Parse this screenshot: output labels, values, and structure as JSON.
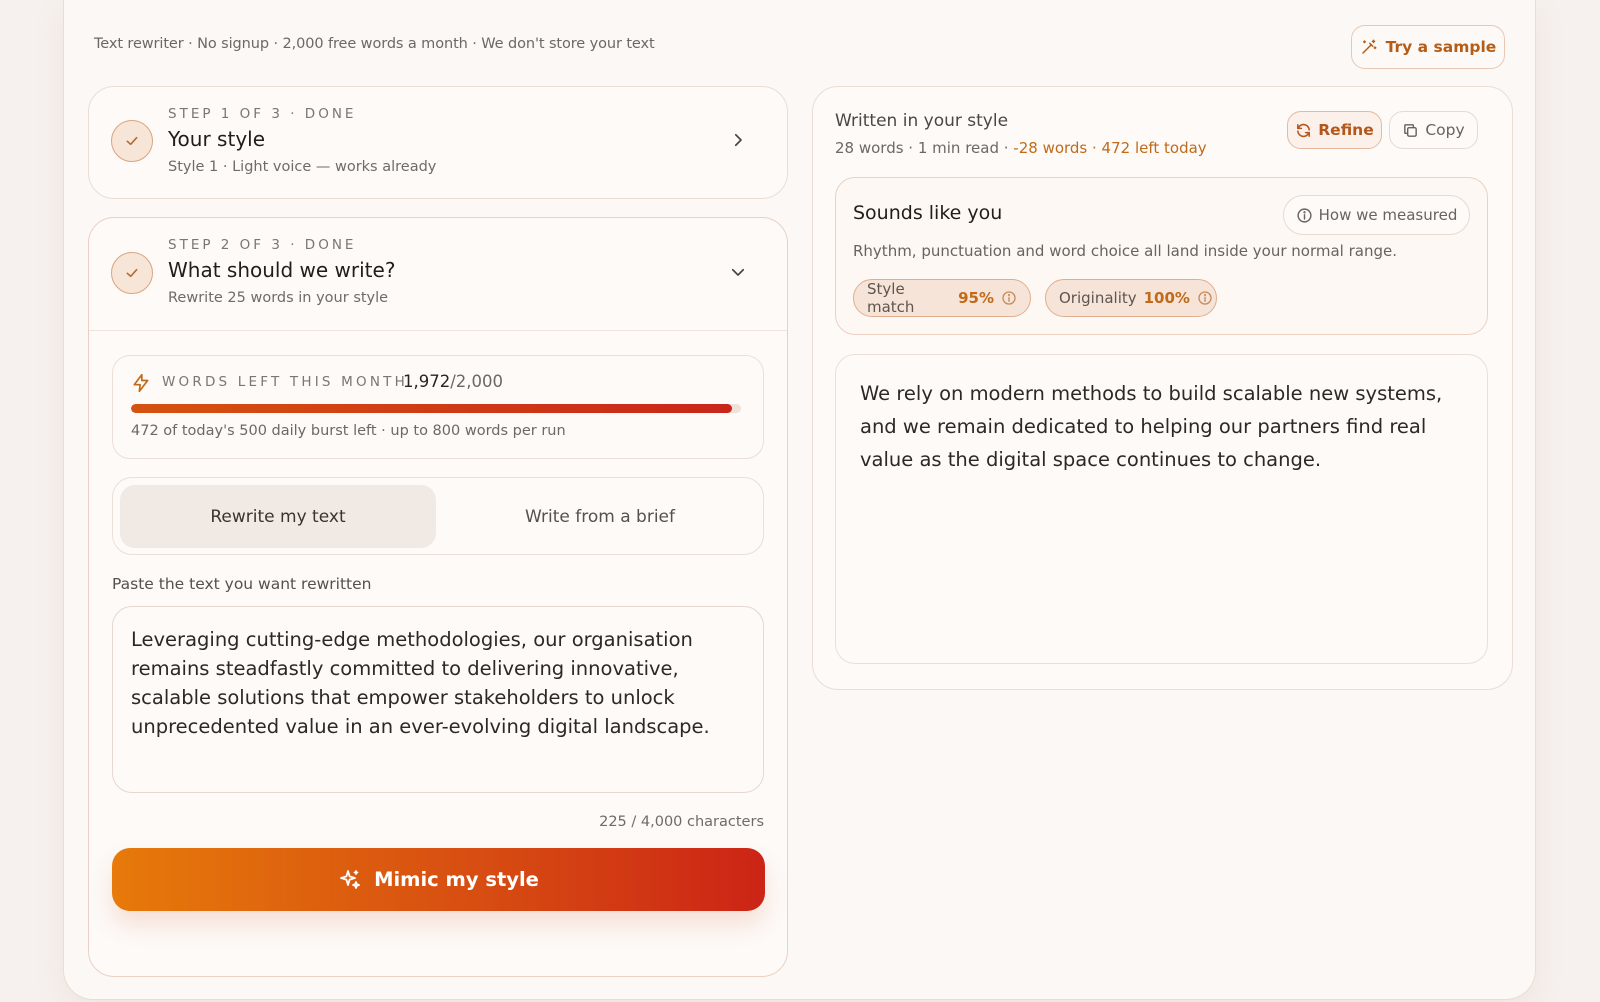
{
  "topbar": {
    "tagline": "Text rewriter · No signup · 2,000 free words a month · We don't store your text",
    "sample_button": "Try a sample"
  },
  "step1": {
    "kicker": "STEP 1 OF 3 · DONE",
    "title": "Your style",
    "subtitle": "Style 1 · Light voice — works already"
  },
  "step2": {
    "kicker": "STEP 2 OF 3 · DONE",
    "title": "What should we write?",
    "subtitle": "Rewrite 25 words in your style",
    "quota": {
      "label": "WORDS LEFT THIS MONTH",
      "used": "1,972",
      "total": "/2,000",
      "fraction": 0.986,
      "note": "472 of today's 500 daily burst left · up to 800 words per run"
    },
    "modes": {
      "active": "Rewrite my text",
      "inactive": "Write from a brief"
    },
    "input_label": "Paste the text you want rewritten",
    "input_value": "Leveraging cutting-edge methodologies, our organisation remains steadfastly committed to delivering innovative, scalable solutions that empower stakeholders to unlock unprecedented value in an ever-evolving digital landscape.",
    "char_count": "225 / 4,000 characters",
    "cta": "Mimic my style"
  },
  "output": {
    "title": "Written in your style",
    "meta_plain": "28 words · 1 min read · ",
    "meta_delta": "-28 words · 472 left today",
    "refine_button": "Refine",
    "copy_button": "Copy",
    "sounds": {
      "title": "Sounds like you",
      "how_button": "How we measured",
      "description": "Rhythm, punctuation and word choice all land inside your normal range.",
      "style_match_label": "Style match",
      "style_match_value": "95%",
      "originality_label": "Originality",
      "originality_value": "100%"
    },
    "text": "We rely on modern methods to build scalable new systems, and we remain dedicated to helping our partners find real value as the digital space continues to change."
  },
  "colors": {
    "accent": "#d5520f",
    "accent_text": "#c06a1a",
    "background": "#f6f1ee"
  }
}
